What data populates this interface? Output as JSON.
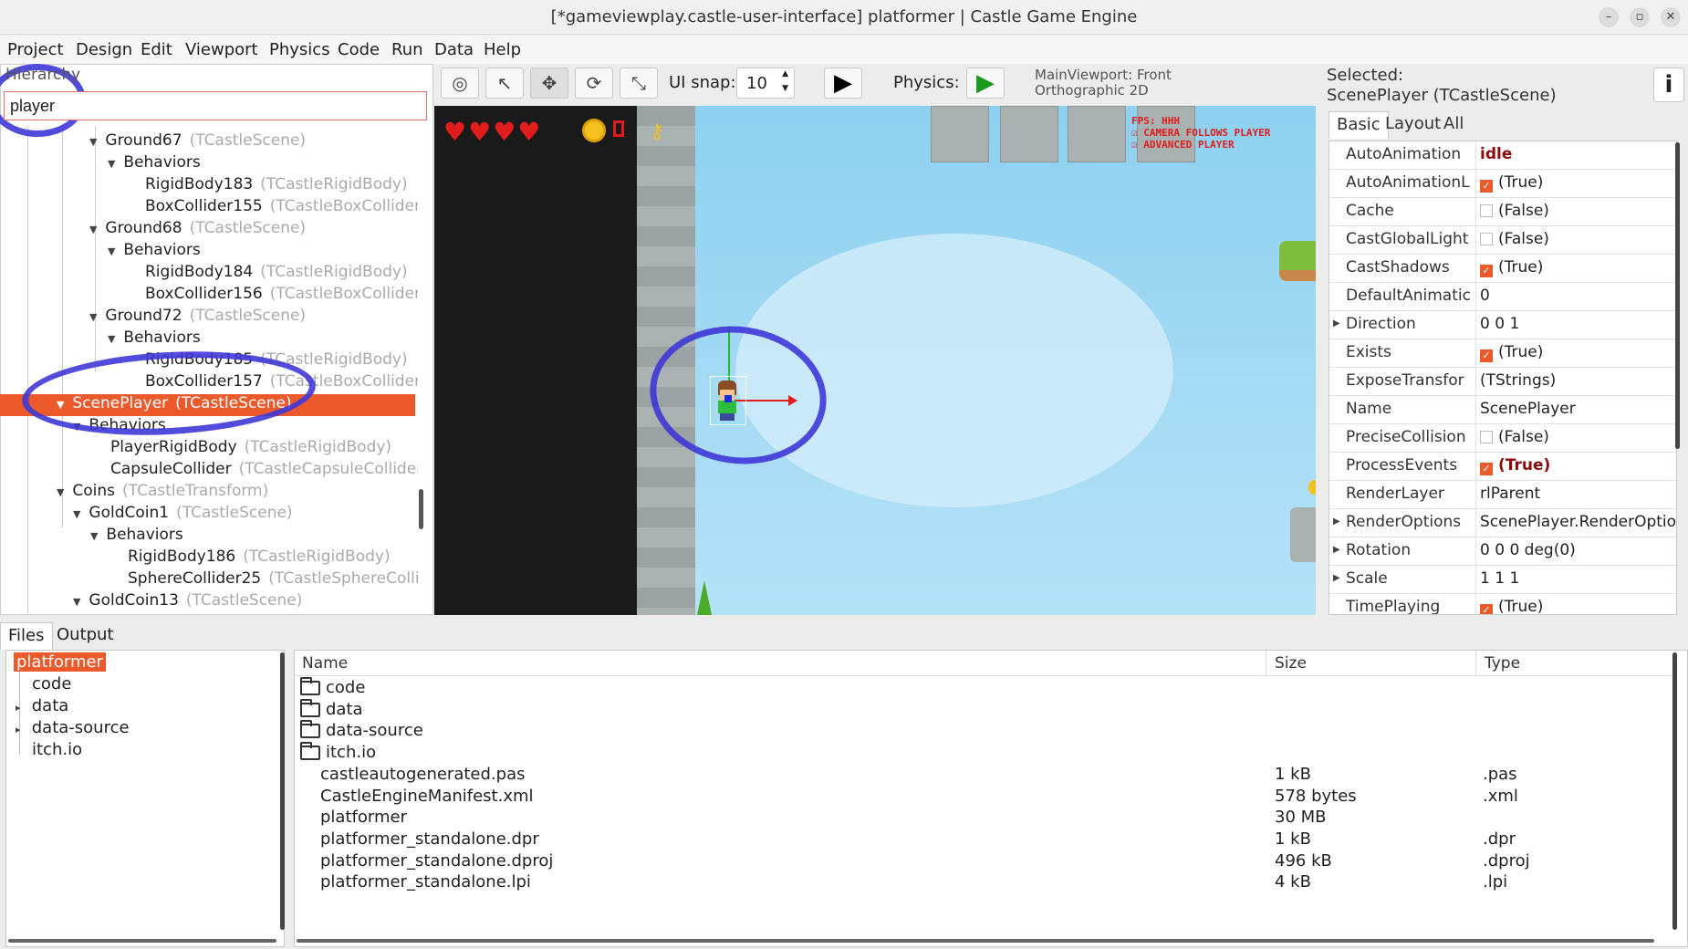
{
  "window": {
    "title": "[*gameviewplay.castle-user-interface] platformer | Castle Game Engine"
  },
  "menu": [
    "Project",
    "Design",
    "Edit",
    "Viewport",
    "Physics",
    "Code",
    "Run",
    "Data",
    "Help"
  ],
  "hierarchy": {
    "label": "Hierarchy",
    "search_value": "player",
    "items": [
      {
        "name": "Ground67",
        "cls": "(TCastleScene)"
      },
      {
        "name": "Behaviors",
        "cls": ""
      },
      {
        "name": "RigidBody183",
        "cls": "(TCastleRigidBody)"
      },
      {
        "name": "BoxCollider155",
        "cls": "(TCastleBoxCollider)"
      },
      {
        "name": "Ground68",
        "cls": "(TCastleScene)"
      },
      {
        "name": "Behaviors",
        "cls": ""
      },
      {
        "name": "RigidBody184",
        "cls": "(TCastleRigidBody)"
      },
      {
        "name": "BoxCollider156",
        "cls": "(TCastleBoxCollider)"
      },
      {
        "name": "Ground72",
        "cls": "(TCastleScene)"
      },
      {
        "name": "Behaviors",
        "cls": ""
      },
      {
        "name": "RigidBody185",
        "cls": "(TCastleRigidBody)"
      },
      {
        "name": "BoxCollider157",
        "cls": "(TCastleBoxCollider)"
      },
      {
        "name": "ScenePlayer",
        "cls": "(TCastleScene)"
      },
      {
        "name": "Behaviors",
        "cls": ""
      },
      {
        "name": "PlayerRigidBody",
        "cls": "(TCastleRigidBody)"
      },
      {
        "name": "CapsuleCollider",
        "cls": "(TCastleCapsuleCollider)"
      },
      {
        "name": "Coins",
        "cls": "(TCastleTransform)"
      },
      {
        "name": "GoldCoin1",
        "cls": "(TCastleScene)"
      },
      {
        "name": "Behaviors",
        "cls": ""
      },
      {
        "name": "RigidBody186",
        "cls": "(TCastleRigidBody)"
      },
      {
        "name": "SphereCollider25",
        "cls": "(TCastleSphereCollid"
      },
      {
        "name": "GoldCoin13",
        "cls": "(TCastleScene)"
      }
    ]
  },
  "toolbar": {
    "ui_snap_label": "UI snap:",
    "ui_snap_value": "10",
    "physics_label": "Physics:",
    "viewport_info": "MainViewport: Front Orthographic 2D"
  },
  "viewport": {
    "fps_text": "FPS: HHH",
    "camera_follows": "CAMERA FOLLOWS PLAYER",
    "advanced_player": "ADVANCED PLAYER",
    "hearts": 4
  },
  "inspector": {
    "selected_label": "Selected:",
    "selected_value": "ScenePlayer (TCastleScene)",
    "info_icon": "i",
    "tabs": [
      "Basic",
      "Layout",
      "All"
    ],
    "properties": [
      {
        "name": "AutoAnimation",
        "value": "idle",
        "bold": true
      },
      {
        "name": "AutoAnimationL",
        "value": "(True)",
        "check": true
      },
      {
        "name": "Cache",
        "value": "(False)",
        "check": false
      },
      {
        "name": "CastGlobalLight",
        "value": "(False)",
        "check": false
      },
      {
        "name": "CastShadows",
        "value": "(True)",
        "check": true
      },
      {
        "name": "DefaultAnimatic",
        "value": "0"
      },
      {
        "name": "Direction",
        "value": "0 0 1",
        "expand": true
      },
      {
        "name": "Exists",
        "value": "(True)",
        "check": true
      },
      {
        "name": "ExposeTransfor",
        "value": "(TStrings)"
      },
      {
        "name": "Name",
        "value": "ScenePlayer"
      },
      {
        "name": "PreciseCollision",
        "value": "(False)",
        "check": false
      },
      {
        "name": "ProcessEvents",
        "value": "(True)",
        "check": true,
        "bold": true
      },
      {
        "name": "RenderLayer",
        "value": "rlParent"
      },
      {
        "name": "RenderOptions",
        "value": "ScenePlayer.RenderOptions",
        "expand": true
      },
      {
        "name": "Rotation",
        "value": "0 0 0 deg(0)",
        "expand": true
      },
      {
        "name": "Scale",
        "value": "1 1 1",
        "expand": true
      },
      {
        "name": "TimePlaying",
        "value": "(True)",
        "check": true
      }
    ]
  },
  "bottom_tabs": [
    "Files",
    "Output"
  ],
  "file_tree": {
    "root": "platformer",
    "items": [
      "code",
      "data",
      "data-source",
      "itch.io"
    ]
  },
  "file_list": {
    "headers": {
      "name": "Name",
      "size": "Size",
      "type": "Type"
    },
    "rows": [
      {
        "name": "code",
        "size": "",
        "type": "",
        "folder": true
      },
      {
        "name": "data",
        "size": "",
        "type": "",
        "folder": true
      },
      {
        "name": "data-source",
        "size": "",
        "type": "",
        "folder": true
      },
      {
        "name": "itch.io",
        "size": "",
        "type": "",
        "folder": true
      },
      {
        "name": "castleautogenerated.pas",
        "size": "1 kB",
        "type": ".pas"
      },
      {
        "name": "CastleEngineManifest.xml",
        "size": "578 bytes",
        "type": ".xml"
      },
      {
        "name": "platformer",
        "size": "30 MB",
        "type": ""
      },
      {
        "name": "platformer_standalone.dpr",
        "size": "1 kB",
        "type": ".dpr"
      },
      {
        "name": "platformer_standalone.dproj",
        "size": "496 kB",
        "type": ".dproj"
      },
      {
        "name": "platformer_standalone.lpi",
        "size": "4 kB",
        "type": ".lpi"
      }
    ]
  }
}
